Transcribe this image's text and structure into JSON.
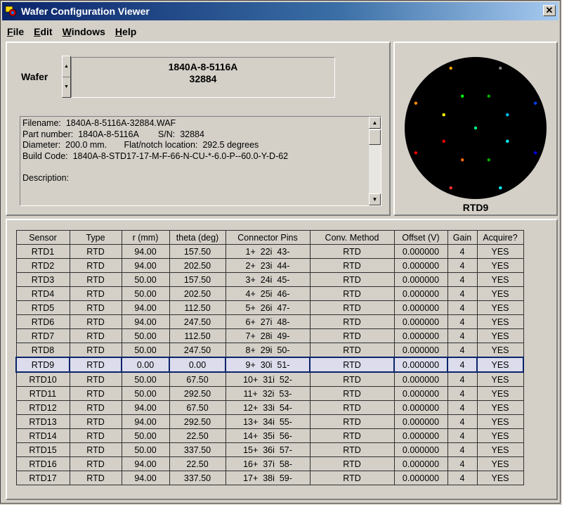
{
  "window": {
    "title": "Wafer Configuration Viewer",
    "close_glyph": "✕"
  },
  "menu": [
    {
      "underline": "F",
      "rest": "ile"
    },
    {
      "underline": "E",
      "rest": "dit"
    },
    {
      "underline": "W",
      "rest": "indows"
    },
    {
      "underline": "H",
      "rest": "elp"
    }
  ],
  "wafer": {
    "label": "Wafer",
    "part": "1840A-8-5116A",
    "serial": "32884",
    "info_lines": [
      "Filename:  1840A-8-5116A-32884.WAF",
      "Part number:  1840A-8-5116A        S/N:  32884",
      "Diameter:  200.0 mm.       Flat/notch location:  292.5 degrees",
      "Build Code:  1840A-8-STD17-17-M-F-66-N-CU-*-6.0-P--60.0-Y-D-62",
      "",
      "Description:"
    ]
  },
  "map": {
    "selected_label": "RTD9",
    "background": "#000000",
    "points": [
      {
        "r": 94,
        "theta": 157.5,
        "color": "#ff8c00"
      },
      {
        "r": 94,
        "theta": 202.5,
        "color": "#ff0000"
      },
      {
        "r": 50,
        "theta": 157.5,
        "color": "#ffff00"
      },
      {
        "r": 50,
        "theta": 202.5,
        "color": "#ff0000"
      },
      {
        "r": 94,
        "theta": 112.5,
        "color": "#ffa500"
      },
      {
        "r": 94,
        "theta": 247.5,
        "color": "#ff3030"
      },
      {
        "r": 50,
        "theta": 112.5,
        "color": "#00ff00"
      },
      {
        "r": 50,
        "theta": 247.5,
        "color": "#ff6600"
      },
      {
        "r": 0,
        "theta": 0,
        "color": "#00ff80"
      },
      {
        "r": 50,
        "theta": 67.5,
        "color": "#00b000"
      },
      {
        "r": 50,
        "theta": 292.5,
        "color": "#00b000"
      },
      {
        "r": 94,
        "theta": 67.5,
        "color": "#808080"
      },
      {
        "r": 94,
        "theta": 292.5,
        "color": "#00ffff"
      },
      {
        "r": 50,
        "theta": 22.5,
        "color": "#00bfff"
      },
      {
        "r": 50,
        "theta": 337.5,
        "color": "#00ffff"
      },
      {
        "r": 94,
        "theta": 22.5,
        "color": "#0040ff"
      },
      {
        "r": 94,
        "theta": 337.5,
        "color": "#0000ff"
      }
    ]
  },
  "table": {
    "headers": [
      "Sensor",
      "Type",
      "r (mm)",
      "theta (deg)",
      "Connector Pins",
      "Conv. Method",
      "Offset (V)",
      "Gain",
      "Acquire?"
    ],
    "selected_row": 8,
    "rows": [
      [
        "RTD1",
        "RTD",
        "94.00",
        "157.50",
        "1+  22i  43-",
        "RTD",
        "0.000000",
        "4",
        "YES"
      ],
      [
        "RTD2",
        "RTD",
        "94.00",
        "202.50",
        "2+  23i  44-",
        "RTD",
        "0.000000",
        "4",
        "YES"
      ],
      [
        "RTD3",
        "RTD",
        "50.00",
        "157.50",
        "3+  24i  45-",
        "RTD",
        "0.000000",
        "4",
        "YES"
      ],
      [
        "RTD4",
        "RTD",
        "50.00",
        "202.50",
        "4+  25i  46-",
        "RTD",
        "0.000000",
        "4",
        "YES"
      ],
      [
        "RTD5",
        "RTD",
        "94.00",
        "112.50",
        "5+  26i  47-",
        "RTD",
        "0.000000",
        "4",
        "YES"
      ],
      [
        "RTD6",
        "RTD",
        "94.00",
        "247.50",
        "6+  27i  48-",
        "RTD",
        "0.000000",
        "4",
        "YES"
      ],
      [
        "RTD7",
        "RTD",
        "50.00",
        "112.50",
        "7+  28i  49-",
        "RTD",
        "0.000000",
        "4",
        "YES"
      ],
      [
        "RTD8",
        "RTD",
        "50.00",
        "247.50",
        "8+  29i  50-",
        "RTD",
        "0.000000",
        "4",
        "YES"
      ],
      [
        "RTD9",
        "RTD",
        "0.00",
        "0.00",
        "9+  30i  51-",
        "RTD",
        "0.000000",
        "4",
        "YES"
      ],
      [
        "RTD10",
        "RTD",
        "50.00",
        "67.50",
        "10+  31i  52-",
        "RTD",
        "0.000000",
        "4",
        "YES"
      ],
      [
        "RTD11",
        "RTD",
        "50.00",
        "292.50",
        "11+  32i  53-",
        "RTD",
        "0.000000",
        "4",
        "YES"
      ],
      [
        "RTD12",
        "RTD",
        "94.00",
        "67.50",
        "12+  33i  54-",
        "RTD",
        "0.000000",
        "4",
        "YES"
      ],
      [
        "RTD13",
        "RTD",
        "94.00",
        "292.50",
        "13+  34i  55-",
        "RTD",
        "0.000000",
        "4",
        "YES"
      ],
      [
        "RTD14",
        "RTD",
        "50.00",
        "22.50",
        "14+  35i  56-",
        "RTD",
        "0.000000",
        "4",
        "YES"
      ],
      [
        "RTD15",
        "RTD",
        "50.00",
        "337.50",
        "15+  36i  57-",
        "RTD",
        "0.000000",
        "4",
        "YES"
      ],
      [
        "RTD16",
        "RTD",
        "94.00",
        "22.50",
        "16+  37i  58-",
        "RTD",
        "0.000000",
        "4",
        "YES"
      ],
      [
        "RTD17",
        "RTD",
        "94.00",
        "337.50",
        "17+  38i  59-",
        "RTD",
        "0.000000",
        "4",
        "YES"
      ]
    ]
  }
}
